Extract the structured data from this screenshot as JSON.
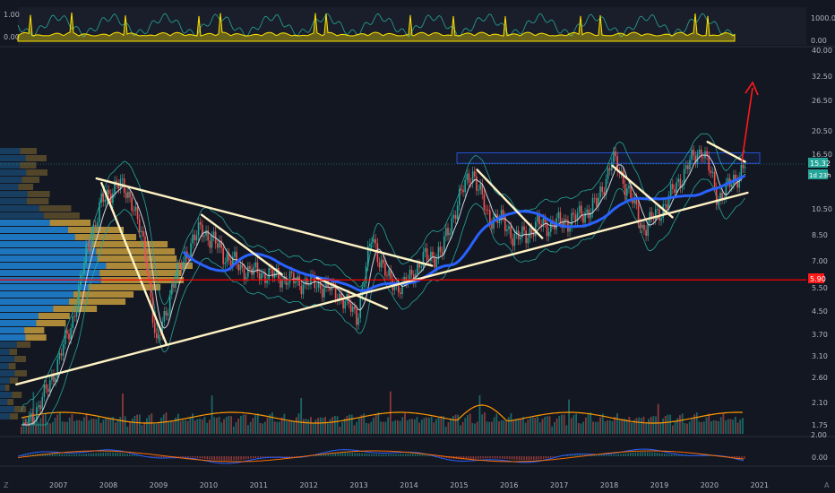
{
  "colors": {
    "background": "#131722",
    "price": "#26a69a",
    "price_down": "#ef5350",
    "ma_long": "#2962ff",
    "ma_short": "#d1d4dc",
    "bollinger": "#26a69a",
    "trendline": "#fff3c4",
    "volume_profile_up": "#2196f3",
    "volume_profile_down": "#e0b040",
    "volume_ma": "#ff9800",
    "osc_line": "#ffe300",
    "macd": "#2962ff",
    "signal": "#ff6d00",
    "support_level": "#ff0000",
    "arrow": "#ff1a1a",
    "current_badge": "#26a69a"
  },
  "top_panel": {
    "left_labels": [
      "1.00",
      "0.00"
    ],
    "right_labels": [
      "1000.00",
      "0.00"
    ]
  },
  "price_axis": {
    "labels": [
      "40.00",
      "32.50",
      "26.50",
      "20.50",
      "16.50",
      "10.50",
      "8.50",
      "7.00",
      "5.50",
      "4.50",
      "3.70",
      "3.10",
      "2.60",
      "2.10",
      "1.75",
      "0.00"
    ],
    "top_value": "2.00",
    "current_price": "15.32",
    "countdown": "1d 23h",
    "support_price": "5.90"
  },
  "time_axis": {
    "labels": [
      "2007",
      "2008",
      "2009",
      "2010",
      "2011",
      "2012",
      "2013",
      "2014",
      "2015",
      "2016",
      "2017",
      "2018",
      "2019",
      "2020",
      "2021"
    ]
  },
  "chart_data": {
    "type": "line",
    "scale": "log",
    "x_unit": "year",
    "series": [
      {
        "x": [
          2006.3,
          2006.8,
          2007.3,
          2007.6,
          2007.9,
          2008.2,
          2008.5,
          2008.8,
          2009.0,
          2009.3,
          2009.6,
          2009.9,
          2010.3,
          2010.7,
          2011.0,
          2011.4,
          2011.8,
          2012.2,
          2012.6,
          2013.0,
          2013.3,
          2013.6,
          2013.9,
          2014.3,
          2014.7,
          2015.0,
          2015.3,
          2015.6,
          2015.9,
          2016.2,
          2016.6,
          2017.0,
          2017.4,
          2017.8,
          2018.1,
          2018.4,
          2018.7,
          2019.0,
          2019.3,
          2019.6,
          2019.9,
          2020.2,
          2020.5,
          2020.75
        ],
        "y": [
          1.6,
          2.3,
          4.0,
          7.5,
          11.0,
          13.0,
          11.5,
          7.0,
          3.3,
          5.5,
          7.5,
          9.0,
          7.5,
          6.5,
          6.3,
          6.1,
          5.8,
          5.7,
          5.3,
          4.3,
          8.5,
          6.0,
          5.5,
          7.0,
          7.5,
          11.0,
          14.5,
          10.0,
          9.5,
          8.2,
          9.2,
          9.3,
          9.8,
          11.0,
          16.0,
          12.5,
          9.0,
          10.0,
          12.0,
          15.0,
          17.5,
          11.5,
          13.0,
          15.32
        ]
      }
    ],
    "trendlines": [
      {
        "name": "upper",
        "x": [
          2007.8,
          2014.5
        ],
        "y": [
          13.5,
          6.7
        ]
      },
      {
        "name": "rising-support",
        "x": [
          2006.2,
          2020.8
        ],
        "y": [
          2.45,
          12.0
        ]
      },
      {
        "name": "resistance",
        "x": [
          2020.0,
          2020.75
        ],
        "y": [
          18.5,
          15.5
        ]
      },
      {
        "name": "channel-1",
        "x": [
          2007.9,
          2009.2
        ],
        "y": [
          13.0,
          3.4
        ]
      },
      {
        "name": "channel-2",
        "x": [
          2009.9,
          2011.5
        ],
        "y": [
          10.0,
          6.2
        ]
      },
      {
        "name": "channel-3",
        "x": [
          2012.2,
          2013.6
        ],
        "y": [
          6.0,
          4.6
        ]
      },
      {
        "name": "channel-4",
        "x": [
          2015.4,
          2016.7
        ],
        "y": [
          14.5,
          8.3
        ]
      },
      {
        "name": "channel-5",
        "x": [
          2018.1,
          2019.3
        ],
        "y": [
          15.0,
          9.8
        ]
      }
    ],
    "support_level": 5.9,
    "resistance_zone": [
      15.3,
      16.7
    ],
    "ylim": [
      1.5,
      45
    ]
  }
}
